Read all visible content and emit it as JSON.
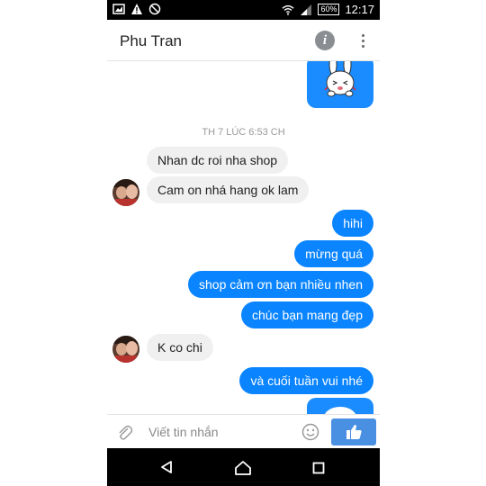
{
  "statusbar": {
    "left_icons": [
      "picture-icon",
      "warning-icon",
      "blocked-icon"
    ],
    "battery": "60%",
    "time": "12:17"
  },
  "header": {
    "title": "Phu Tran",
    "info_icon": "i"
  },
  "conversation": {
    "timestamp": "TH 7 LÚC 6:53 CH",
    "messages": [
      {
        "side": "in",
        "text": "Nhan dc roi nha shop"
      },
      {
        "side": "in",
        "text": "Cam on nhá hang ok lam"
      },
      {
        "side": "out",
        "text": "hihi"
      },
      {
        "side": "out",
        "text": "mừng quá"
      },
      {
        "side": "out",
        "text": "shop cảm ơn bạn nhiều nhen"
      },
      {
        "side": "out",
        "text": "chúc bạn mang đẹp"
      },
      {
        "side": "in",
        "text": "K co chi"
      },
      {
        "side": "out",
        "text": "và cuối tuần vui nhé"
      }
    ]
  },
  "composer": {
    "placeholder": "Viết tin nhắn"
  },
  "colors": {
    "outgoing_bubble": "#0a84ff",
    "incoming_bubble": "#f1f0f0",
    "like_button": "#4a90e2"
  }
}
